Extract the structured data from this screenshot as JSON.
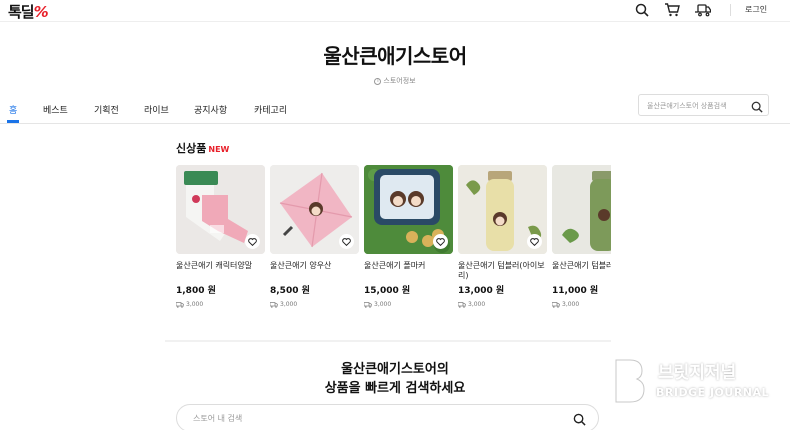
{
  "header": {
    "logo_text": "톡딜",
    "logo_mark": "%",
    "icons": [
      "search-icon",
      "cart-icon",
      "delivery-truck-icon"
    ],
    "login_label": "로그인"
  },
  "store": {
    "title": "울산큰애기스토어",
    "info_label": "스토어정보"
  },
  "tabs": [
    "홈",
    "베스트",
    "기획전",
    "라이브",
    "공지사항",
    "카테고리"
  ],
  "search_top": {
    "placeholder": "울산큰애기스토어 상품검색"
  },
  "new_section": {
    "title": "신상품",
    "badge": "NEW"
  },
  "products": [
    {
      "name": "울산큰애기 캐릭터양말",
      "price": "1,800 원",
      "shipping": "3,000"
    },
    {
      "name": "울산큰애기 양우산",
      "price": "8,500 원",
      "shipping": "3,000"
    },
    {
      "name": "울산큰애기 폴마커",
      "price": "15,000 원",
      "shipping": "3,000"
    },
    {
      "name": "울산큰애기 텀블러(아이보리)",
      "price": "13,000 원",
      "shipping": "3,000"
    },
    {
      "name": "울산큰애기 텀블러(그린)",
      "price": "11,000 원",
      "shipping": "3,000"
    }
  ],
  "promo": {
    "line1": "울산큰애기스토어의",
    "line2": "상품을 빠르게 검색하세요"
  },
  "search_bottom": {
    "placeholder": "스토어 내 검색"
  },
  "watermark": {
    "text_ko": "브릿지저널",
    "text_en": "BRIDGE JOURNAL"
  },
  "colors": {
    "accent": "#1a73e8",
    "brand_red": "#e8202a"
  }
}
